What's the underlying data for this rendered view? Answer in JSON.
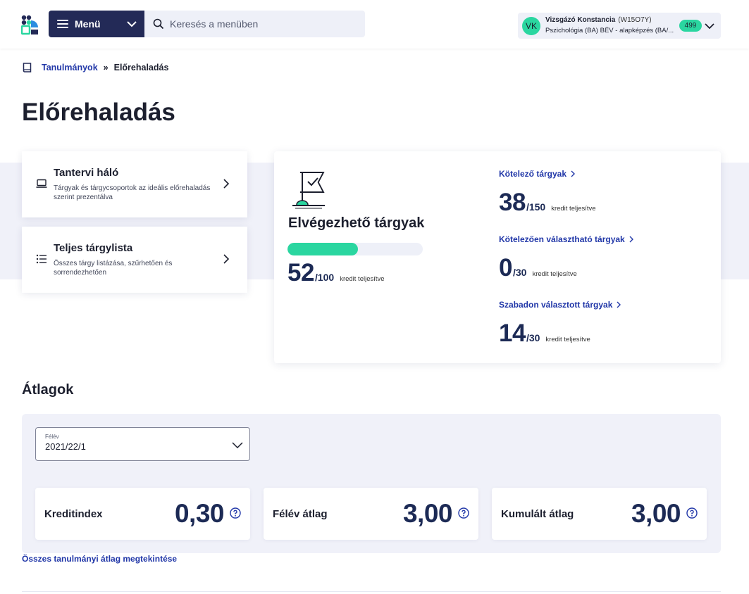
{
  "header": {
    "menu_label": "Menü",
    "search_placeholder": "Keresés a menüben",
    "user": {
      "initials": "VK",
      "name": "Vizsgázó Konstancia",
      "code": "(W15O7Y)",
      "program": "Pszichológia (BA) BÉV - alapképzés (BA/...",
      "badge": "499"
    }
  },
  "breadcrumb": {
    "root": "Tanulmányok",
    "separator": "»",
    "current": "Előrehaladás"
  },
  "page_title": "Előrehaladás",
  "nav_cards": [
    {
      "title": "Tantervi háló",
      "description": "Tárgyak és tárgycsoportok az ideális előrehaladás szerint prezentálva",
      "icon": "laptop-icon"
    },
    {
      "title": "Teljes tárgylista",
      "description": "Összes tárgy listázása, szűrhetően és sorrendezhetően",
      "icon": "list-icon"
    }
  ],
  "progress": {
    "title": "Elvégezhető tárgyak",
    "completed": "52",
    "total": "/100",
    "credit_label": "kredit teljesítve",
    "fraction": 0.52,
    "categories": [
      {
        "label": "Kötelező tárgyak",
        "completed": "38",
        "total": "/150",
        "credit_label": "kredit teljesítve"
      },
      {
        "label": "Kötelezően választható tárgyak",
        "completed": "0",
        "total": "/30",
        "credit_label": "kredit teljesítve"
      },
      {
        "label": "Szabadon választott tárgyak",
        "completed": "14",
        "total": "/30",
        "credit_label": "kredit teljesítve"
      }
    ]
  },
  "averages": {
    "title": "Átlagok",
    "semester_label": "Félév",
    "semester_value": "2021/22/1",
    "cards": [
      {
        "label": "Kreditindex",
        "value": "0,30"
      },
      {
        "label": "Félév átlag",
        "value": "3,00"
      },
      {
        "label": "Kumulált átlag",
        "value": "3,00"
      }
    ],
    "all_link": "Összes tanulmányi átlag megtekintése"
  },
  "colors": {
    "navy": "#232a57",
    "accent_green": "#2ad6a0",
    "link_blue": "#2137a8",
    "panel_bg": "#f0f1f9"
  }
}
